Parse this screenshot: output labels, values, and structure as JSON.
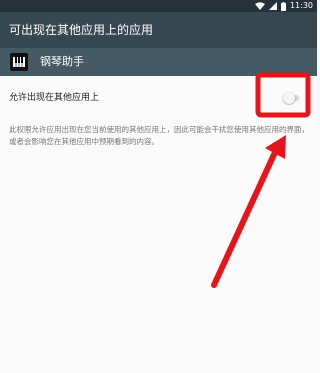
{
  "status_bar": {
    "time": "11:30",
    "icons": [
      "wifi-icon",
      "signal-icon",
      "battery-icon"
    ]
  },
  "app_bar": {
    "title": "可出现在其他应用上的应用"
  },
  "app_header": {
    "icon": "piano-keys-icon",
    "app_name": "钢琴助手"
  },
  "permission": {
    "label": "允许出现在其他应用上",
    "enabled": false,
    "description": "此权限允许应用出现在您当前使用的其他应用上，因此可能会干扰您使用其他应用的界面，或者会影响您在其他应用中预期看到的内容。"
  },
  "annotation": {
    "color": "#e8141b",
    "shapes": [
      "highlight-box",
      "pointer-arrow"
    ]
  },
  "colors": {
    "status_bar": "#263238",
    "app_bar": "#37474f",
    "app_header": "#455a64",
    "background": "#fafafa"
  }
}
